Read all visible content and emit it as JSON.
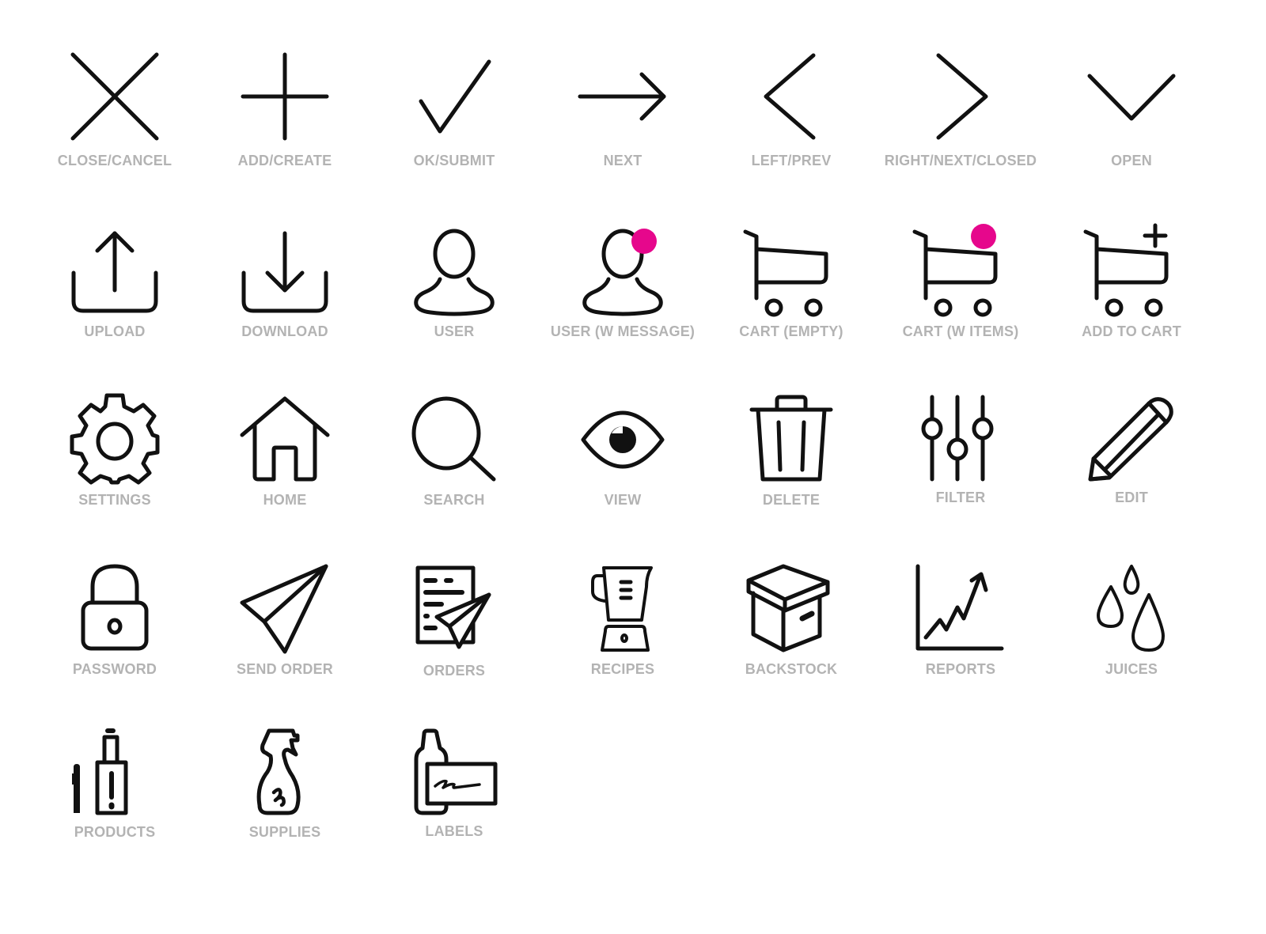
{
  "accent_color": "#e6078c",
  "label_color": "#b3b3b3",
  "icon_color": "#111111",
  "icons": [
    {
      "label": "CLOSE/CANCEL",
      "icon": "close-icon"
    },
    {
      "label": "ADD/CREATE",
      "icon": "plus-icon"
    },
    {
      "label": "OK/SUBMIT",
      "icon": "checkmark-icon"
    },
    {
      "label": "NEXT",
      "icon": "arrow-right-icon"
    },
    {
      "label": "LEFT/PREV",
      "icon": "chevron-left-icon"
    },
    {
      "label": "RIGHT/NEXT/CLOSED",
      "icon": "chevron-right-icon"
    },
    {
      "label": "OPEN",
      "icon": "chevron-down-icon"
    },
    {
      "label": "UPLOAD",
      "icon": "upload-icon"
    },
    {
      "label": "DOWNLOAD",
      "icon": "download-icon"
    },
    {
      "label": "USER",
      "icon": "user-icon"
    },
    {
      "label": "USER (W MESSAGE)",
      "icon": "user-with-message-icon"
    },
    {
      "label": "CART (EMPTY)",
      "icon": "cart-empty-icon"
    },
    {
      "label": "CART (W ITEMS)",
      "icon": "cart-with-items-icon"
    },
    {
      "label": "ADD TO CART",
      "icon": "add-to-cart-icon"
    },
    {
      "label": "SETTINGS",
      "icon": "gear-icon"
    },
    {
      "label": "HOME",
      "icon": "home-icon"
    },
    {
      "label": "SEARCH",
      "icon": "search-icon"
    },
    {
      "label": "VIEW",
      "icon": "eye-icon"
    },
    {
      "label": "DELETE",
      "icon": "trash-icon"
    },
    {
      "label": "FILTER",
      "icon": "sliders-icon"
    },
    {
      "label": "EDIT",
      "icon": "pencil-icon"
    },
    {
      "label": "PASSWORD",
      "icon": "lock-icon"
    },
    {
      "label": "SEND ORDER",
      "icon": "paper-plane-icon"
    },
    {
      "label": "ORDERS",
      "icon": "document-with-plane-icon"
    },
    {
      "label": "RECIPES",
      "icon": "blender-icon"
    },
    {
      "label": "BACKSTOCK",
      "icon": "box-icon"
    },
    {
      "label": "REPORTS",
      "icon": "line-chart-icon"
    },
    {
      "label": "JUICES",
      "icon": "droplets-icon"
    },
    {
      "label": "PRODUCTS",
      "icon": "vape-device-icon"
    },
    {
      "label": "SUPPLIES",
      "icon": "spray-bottle-icon"
    },
    {
      "label": "LABELS",
      "icon": "bottle-label-icon"
    }
  ]
}
